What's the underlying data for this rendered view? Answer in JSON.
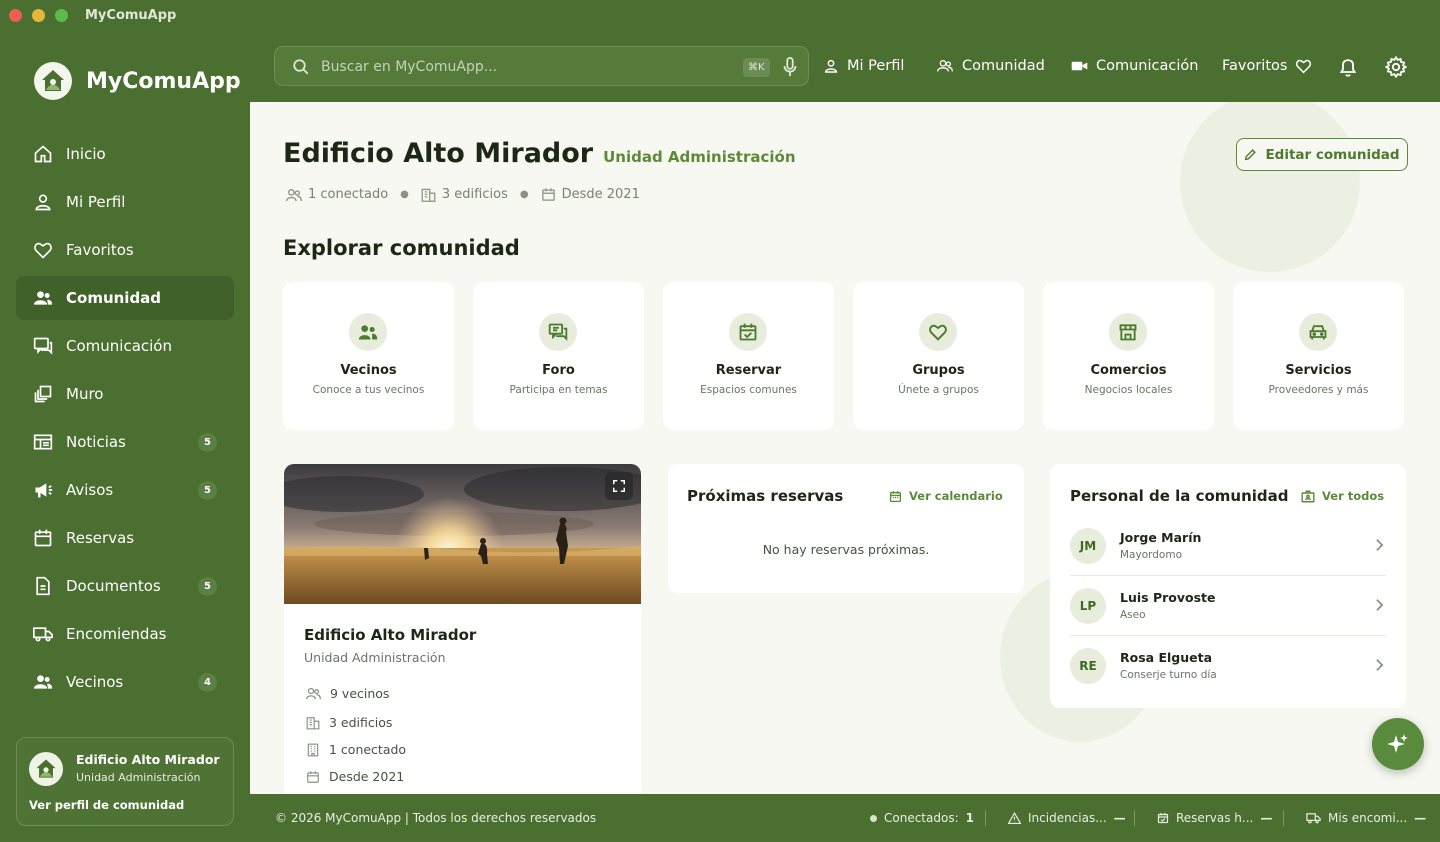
{
  "window": {
    "title": "MyComuApp"
  },
  "brand": {
    "name": "MyComuApp"
  },
  "sidebar": {
    "items": [
      {
        "label": "Inicio",
        "icon": "home-icon",
        "active": false
      },
      {
        "label": "Mi Perfil",
        "icon": "user-icon",
        "active": false
      },
      {
        "label": "Favoritos",
        "icon": "heart-icon",
        "active": false
      },
      {
        "label": "Comunidad",
        "icon": "people-icon",
        "active": true
      },
      {
        "label": "Comunicación",
        "icon": "chat-icon",
        "active": false
      },
      {
        "label": "Muro",
        "icon": "wall-icon",
        "active": false
      },
      {
        "label": "Noticias",
        "icon": "newspaper-icon",
        "badge": "5",
        "active": false
      },
      {
        "label": "Avisos",
        "icon": "megaphone-icon",
        "badge": "5",
        "active": false
      },
      {
        "label": "Reservas",
        "icon": "calendar-icon",
        "active": false
      },
      {
        "label": "Documentos",
        "icon": "document-icon",
        "badge": "5",
        "active": false
      },
      {
        "label": "Encomiendas",
        "icon": "truck-icon",
        "active": false
      },
      {
        "label": "Vecinos",
        "icon": "neighbors-icon",
        "badge": "4",
        "active": false
      }
    ],
    "profile_card": {
      "name": "Edificio Alto Mirador",
      "subtitle": "Unidad Administración",
      "link": "Ver perfil de comunidad"
    }
  },
  "topbar": {
    "search": {
      "placeholder": "Buscar en MyComuApp...",
      "shortcut": "⌘K"
    },
    "nav": {
      "profile": "Mi Perfil",
      "community": "Comunidad",
      "communication": "Comunicación",
      "favorites": "Favoritos"
    }
  },
  "header": {
    "title": "Edificio Alto Mirador",
    "subtitle": "Unidad Administración",
    "edit_label": "Editar comunidad",
    "meta": {
      "connected": "1 conectado",
      "buildings": "3 edificios",
      "since": "Desde 2021"
    }
  },
  "explore": {
    "title": "Explorar comunidad",
    "tiles": [
      {
        "title": "Vecinos",
        "desc": "Conoce a tus vecinos",
        "icon": "people-icon"
      },
      {
        "title": "Foro",
        "desc": "Participa en temas",
        "icon": "forum-icon"
      },
      {
        "title": "Reservar",
        "desc": "Espacios comunes",
        "icon": "calendar-check-icon"
      },
      {
        "title": "Grupos",
        "desc": "Únete a grupos",
        "icon": "heart-icon"
      },
      {
        "title": "Comercios",
        "desc": "Negocios locales",
        "icon": "store-icon"
      },
      {
        "title": "Servicios",
        "desc": "Proveedores y más",
        "icon": "car-icon"
      }
    ]
  },
  "community_card": {
    "name": "Edificio Alto Mirador",
    "subtitle": "Unidad Administración",
    "neighbors": "9 vecinos",
    "buildings": "3 edificios",
    "connected": "1 conectado",
    "since": "Desde 2021"
  },
  "reservations": {
    "title": "Próximas reservas",
    "link": "Ver calendario",
    "empty": "No hay reservas próximas."
  },
  "staff": {
    "title": "Personal de la comunidad",
    "link": "Ver todos",
    "people": [
      {
        "initials": "JM",
        "name": "Jorge Marín",
        "role": "Mayordomo"
      },
      {
        "initials": "LP",
        "name": "Luis Provoste",
        "role": "Aseo"
      },
      {
        "initials": "RE",
        "name": "Rosa Elgueta",
        "role": "Conserje turno día"
      }
    ]
  },
  "footer": {
    "copyright": "© 2026 MyComuApp | Todos los derechos reservados",
    "connected_label": "Conectados:",
    "connected_value": "1",
    "incidents": "Incidencias...",
    "incidents_value": "—",
    "reservations": "Reservas h...",
    "reservations_value": "—",
    "parcels": "Mis encomi...",
    "parcels_value": "—"
  },
  "colors": {
    "sidebar_bg": "#4b6f31",
    "accent": "#5d8a38",
    "main_bg": "#f6f8f1",
    "status_dot": "#d9e6cb"
  }
}
